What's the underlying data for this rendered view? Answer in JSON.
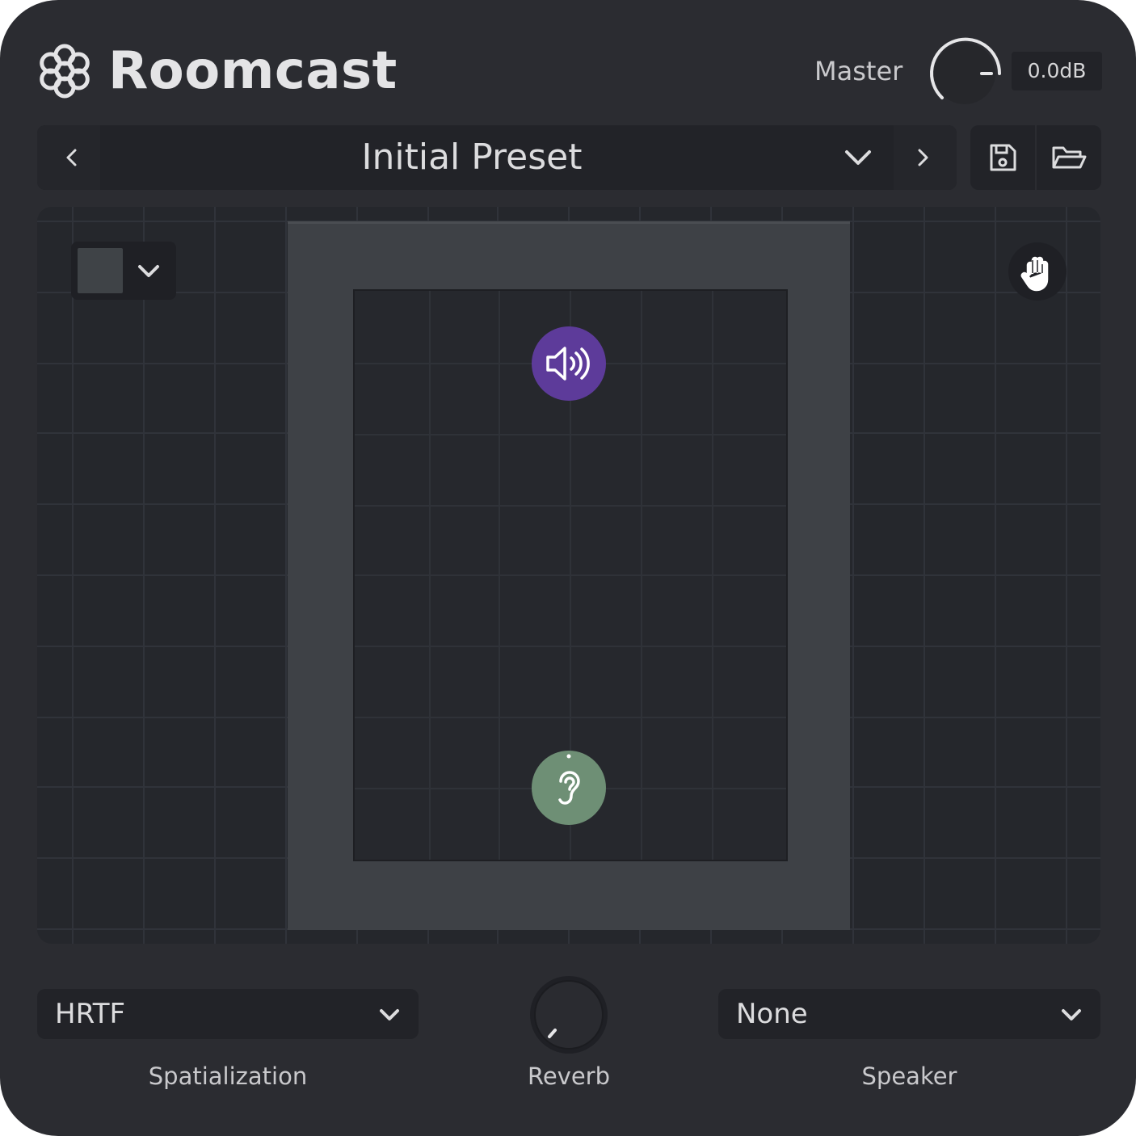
{
  "header": {
    "app_title": "Roomcast",
    "logo_icon": "flower-hexagon-icon",
    "master_label": "Master",
    "master_value": "0.0dB"
  },
  "preset": {
    "name": "Initial Preset",
    "prev_icon": "chevron-left-icon",
    "next_icon": "chevron-right-icon",
    "dropdown_icon": "chevron-down-icon",
    "save_icon": "save-icon",
    "open_icon": "folder-open-icon"
  },
  "canvas": {
    "room_color": "#3f4347",
    "pan_icon": "hand-icon",
    "speaker_icon": "speaker-volume-icon",
    "speaker_color": "#5d3b9a",
    "listener_icon": "ear-icon",
    "listener_color": "#6e8f75"
  },
  "controls": {
    "spatialization": {
      "value": "HRTF",
      "label": "Spatialization"
    },
    "reverb": {
      "label": "Reverb",
      "level": 0.0
    },
    "speaker": {
      "value": "None",
      "label": "Speaker"
    }
  },
  "colors": {
    "background": "#2b2c31",
    "panel": "#222328",
    "text": "#dcdcde"
  }
}
